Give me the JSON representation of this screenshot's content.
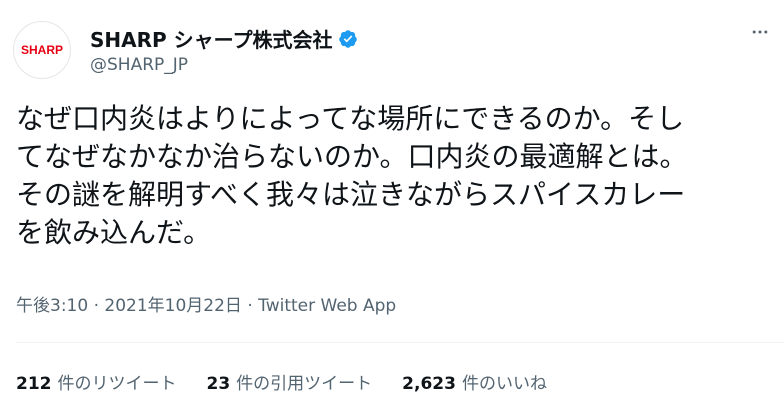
{
  "author": {
    "avatar_text": "SHARP",
    "display_name": "SHARP シャープ株式会社",
    "handle": "@SHARP_JP",
    "verified_icon": "verified-badge-icon",
    "brand_color": "#e60012",
    "verified_color": "#1d9bf0"
  },
  "tweet": {
    "lines": [
      "なぜ口内炎はよりによってな場所にできるのか。そし",
      "てなぜなかなか治らないのか。口内炎の最適解とは。",
      "その謎を解明すべく我々は泣きながらスパイスカレー",
      "を飲み込んだ。"
    ],
    "time": "午後3:10",
    "separator": "·",
    "date": "2021年10月22日",
    "source": "Twitter Web App"
  },
  "stats": {
    "retweets_count": "212",
    "retweets_label": "件のリツイート",
    "quotes_count": "23",
    "quotes_label": "件の引用ツイート",
    "likes_count": "2,623",
    "likes_label": "件のいいね"
  },
  "menu_icon": "more-dots-icon"
}
